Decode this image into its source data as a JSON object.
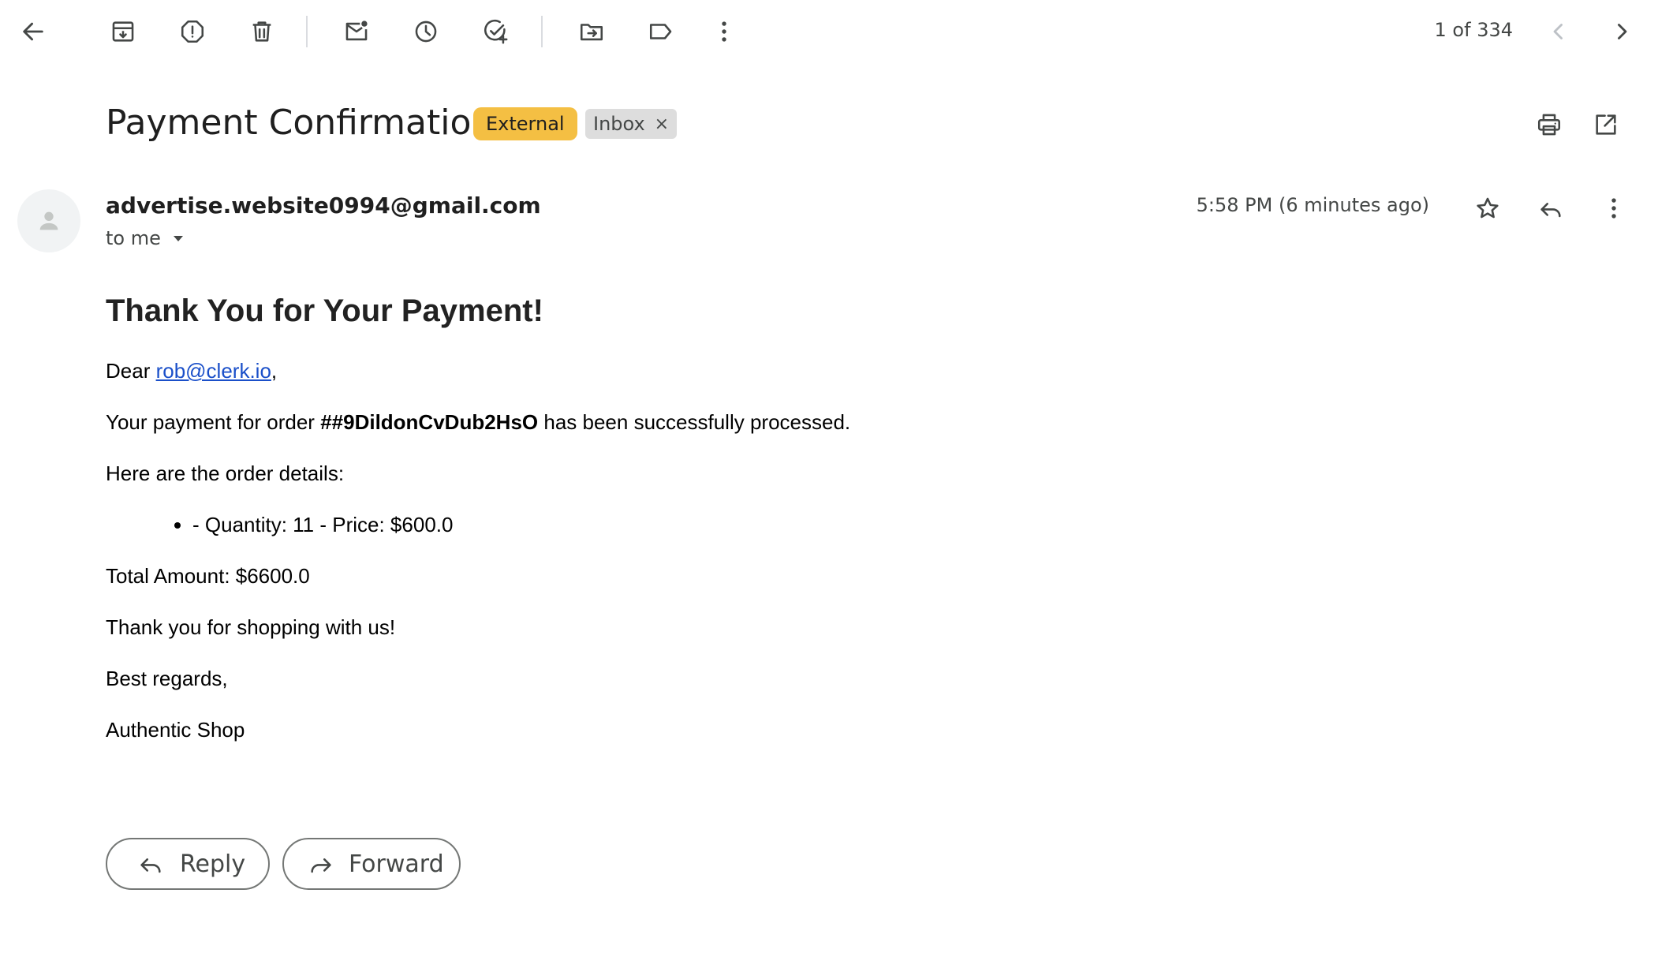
{
  "toolbar": {
    "back_icon": "arrow-left-icon",
    "archive_icon": "archive-icon",
    "spam_icon": "report-spam-icon",
    "delete_icon": "trash-icon",
    "mark_unread_icon": "mark-unread-icon",
    "snooze_icon": "clock-icon",
    "add_task_icon": "add-task-icon",
    "move_icon": "move-to-folder-icon",
    "label_icon": "label-icon",
    "more_icon": "more-vert-icon"
  },
  "pager": {
    "text": "1 of 334"
  },
  "email": {
    "subject": "Payment Confirmation",
    "labels": {
      "external": "External",
      "inbox": "Inbox",
      "inbox_remove": "×"
    },
    "sender": "advertise.website0994@gmail.com",
    "recipient": "to me",
    "time": "5:58 PM (6 minutes ago)",
    "body": {
      "heading": "Thank You for Your Payment!",
      "greeting_prefix": "Dear ",
      "greeting_email": "rob@clerk.io",
      "greeting_suffix": ",",
      "line1_prefix": "Your payment for order ",
      "order_id": "##9DildonCvDub2HsO",
      "line1_suffix": " has been successfully processed.",
      "line2": "Here are the order details:",
      "items": [
        "- Quantity: 11 - Price: $600.0"
      ],
      "total": "Total Amount: $6600.0",
      "thanks": "Thank you for shopping with us!",
      "closing": "Best regards,",
      "signature": "Authentic Shop"
    }
  },
  "actions": {
    "reply": "Reply",
    "forward": "Forward"
  },
  "colors": {
    "external_chip": "#f4bf43",
    "inbox_chip": "#dddddd",
    "link": "#1a4fc9",
    "icon": "#444746"
  }
}
